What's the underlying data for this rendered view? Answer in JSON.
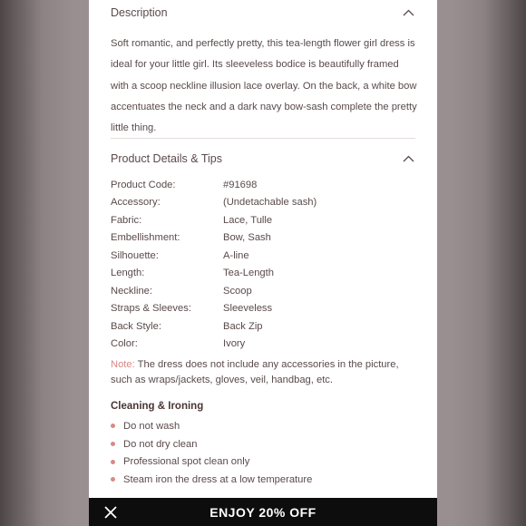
{
  "description": {
    "title": "Description",
    "text": "Soft romantic, and perfectly pretty, this tea-length flower girl dress is ideal for your little girl. Its sleeveless bodice is beautifully framed with a scoop neckline illusion lace overlay. On the back, a white bow accentuates the neck and a dark navy bow-sash complete the pretty little thing."
  },
  "details": {
    "title": "Product Details & Tips",
    "rows": [
      {
        "label": "Product Code:",
        "value": "#91698"
      },
      {
        "label": "Accessory:",
        "value": "(Undetachable sash)"
      },
      {
        "label": "Fabric:",
        "value": "Lace, Tulle"
      },
      {
        "label": "Embellishment:",
        "value": "Bow, Sash"
      },
      {
        "label": "Silhouette:",
        "value": "A-line"
      },
      {
        "label": "Length:",
        "value": "Tea-Length"
      },
      {
        "label": "Neckline:",
        "value": "Scoop"
      },
      {
        "label": "Straps & Sleeves:",
        "value": "Sleeveless"
      },
      {
        "label": "Back Style:",
        "value": "Back Zip"
      },
      {
        "label": "Color:",
        "value": "Ivory"
      }
    ],
    "note_label": "Note:",
    "note_text": " The dress does not include any accessories in the picture, such as wraps/jackets, gloves, veil, handbag, etc."
  },
  "cleaning": {
    "title": "Cleaning & Ironing",
    "items": [
      "Do not wash",
      "Do not dry clean",
      "Professional spot clean only",
      "Steam iron the dress at a low temperature"
    ]
  },
  "promo": {
    "text": "ENJOY 20% OFF"
  },
  "colors": {
    "accent": "#d78a86",
    "text": "#5a4a4b",
    "banner": "#0d0d0d"
  }
}
